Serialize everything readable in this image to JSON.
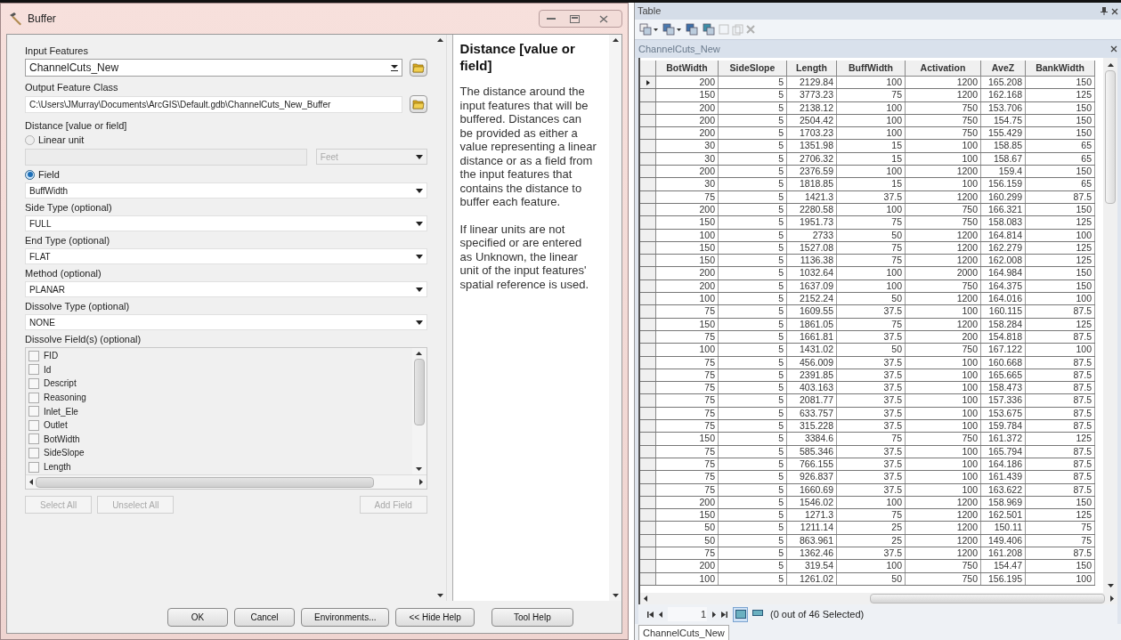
{
  "dialog": {
    "title": "Buffer",
    "params": [
      {
        "kind": "combo",
        "label": "Input Features",
        "value": "ChannelCuts_New"
      },
      {
        "kind": "text",
        "label": "Output Feature Class",
        "value": "C:\\Users\\JMurray\\Documents\\ArcGIS\\Default.gdb\\ChannelCuts_New_Buffer"
      },
      {
        "kind": "distance",
        "label": "Distance [value or field]",
        "options": [
          {
            "label": "Linear unit",
            "selected": false
          },
          {
            "label": "Field",
            "selected": true
          }
        ],
        "unit": "Feet",
        "field": "BuffWidth"
      },
      {
        "kind": "dropdown",
        "label": "Side Type (optional)",
        "value": "FULL"
      },
      {
        "kind": "dropdown",
        "label": "End Type (optional)",
        "value": "FLAT"
      },
      {
        "kind": "dropdown",
        "label": "Method (optional)",
        "value": "PLANAR"
      },
      {
        "kind": "dropdown",
        "label": "Dissolve Type (optional)",
        "value": "NONE"
      },
      {
        "kind": "checklist",
        "label": "Dissolve Field(s) (optional)",
        "items": [
          {
            "label": "FID",
            "checked": false
          },
          {
            "label": "Id",
            "checked": false
          },
          {
            "label": "Descript",
            "checked": false
          },
          {
            "label": "Reasoning",
            "checked": false
          },
          {
            "label": "Inlet_Ele",
            "checked": false
          },
          {
            "label": "Outlet",
            "checked": false
          },
          {
            "label": "BotWidth",
            "checked": false
          },
          {
            "label": "SideSlope",
            "checked": false
          },
          {
            "label": "Length",
            "checked": false
          }
        ],
        "buttons": [
          {
            "label": "Select All",
            "disabled": true
          },
          {
            "label": "Unselect All",
            "disabled": true
          },
          {
            "label": "Add Field",
            "disabled": true
          }
        ]
      }
    ],
    "help": {
      "title": "Distance [value or field]",
      "paragraphs": [
        "The distance around the input features that will be buffered. Distances can be provided as either a value representing a linear distance or as a field from the input features that contains the distance to buffer each feature.",
        "If linear units are not specified or are entered as Unknown, the linear unit of the input features' spatial reference is used."
      ]
    },
    "buttons": [
      "OK",
      "Cancel",
      "Environments...",
      "<< Hide Help"
    ],
    "help_button": "Tool Help"
  },
  "table": {
    "title": "Table",
    "layer_tab": "ChannelCuts_New",
    "columns": [
      "BotWidth",
      "SideSlope",
      "Length",
      "BuffWidth",
      "Activation",
      "AveZ",
      "BankWidth"
    ],
    "rows": [
      {
        "current": true,
        "cells": [
          "200",
          "5",
          "2129.84",
          "100",
          "1200",
          "165.208",
          "150"
        ]
      },
      {
        "current": false,
        "cells": [
          "150",
          "5",
          "3773.23",
          "75",
          "1200",
          "162.168",
          "125"
        ]
      },
      {
        "current": false,
        "cells": [
          "200",
          "5",
          "2138.12",
          "100",
          "750",
          "153.706",
          "150"
        ]
      },
      {
        "current": false,
        "cells": [
          "200",
          "5",
          "2504.42",
          "100",
          "750",
          "154.75",
          "150"
        ]
      },
      {
        "current": false,
        "cells": [
          "200",
          "5",
          "1703.23",
          "100",
          "750",
          "155.429",
          "150"
        ]
      },
      {
        "current": false,
        "cells": [
          "30",
          "5",
          "1351.98",
          "15",
          "100",
          "158.85",
          "65"
        ]
      },
      {
        "current": false,
        "cells": [
          "30",
          "5",
          "2706.32",
          "15",
          "100",
          "158.67",
          "65"
        ]
      },
      {
        "current": false,
        "cells": [
          "200",
          "5",
          "2376.59",
          "100",
          "1200",
          "159.4",
          "150"
        ]
      },
      {
        "current": false,
        "cells": [
          "30",
          "5",
          "1818.85",
          "15",
          "100",
          "156.159",
          "65"
        ]
      },
      {
        "current": false,
        "cells": [
          "75",
          "5",
          "1421.3",
          "37.5",
          "1200",
          "160.299",
          "87.5"
        ]
      },
      {
        "current": false,
        "cells": [
          "200",
          "5",
          "2280.58",
          "100",
          "750",
          "166.321",
          "150"
        ]
      },
      {
        "current": false,
        "cells": [
          "150",
          "5",
          "1951.73",
          "75",
          "750",
          "158.083",
          "125"
        ]
      },
      {
        "current": false,
        "cells": [
          "100",
          "5",
          "2733",
          "50",
          "1200",
          "164.814",
          "100"
        ]
      },
      {
        "current": false,
        "cells": [
          "150",
          "5",
          "1527.08",
          "75",
          "1200",
          "162.279",
          "125"
        ]
      },
      {
        "current": false,
        "cells": [
          "150",
          "5",
          "1136.38",
          "75",
          "1200",
          "162.008",
          "125"
        ]
      },
      {
        "current": false,
        "cells": [
          "200",
          "5",
          "1032.64",
          "100",
          "2000",
          "164.984",
          "150"
        ]
      },
      {
        "current": false,
        "cells": [
          "200",
          "5",
          "1637.09",
          "100",
          "750",
          "164.375",
          "150"
        ]
      },
      {
        "current": false,
        "cells": [
          "100",
          "5",
          "2152.24",
          "50",
          "1200",
          "164.016",
          "100"
        ]
      },
      {
        "current": false,
        "cells": [
          "75",
          "5",
          "1609.55",
          "37.5",
          "100",
          "160.115",
          "87.5"
        ]
      },
      {
        "current": false,
        "cells": [
          "150",
          "5",
          "1861.05",
          "75",
          "1200",
          "158.284",
          "125"
        ]
      },
      {
        "current": false,
        "cells": [
          "75",
          "5",
          "1661.81",
          "37.5",
          "200",
          "154.818",
          "87.5"
        ]
      },
      {
        "current": false,
        "cells": [
          "100",
          "5",
          "1431.02",
          "50",
          "750",
          "167.122",
          "100"
        ]
      },
      {
        "current": false,
        "cells": [
          "75",
          "5",
          "456.009",
          "37.5",
          "100",
          "160.668",
          "87.5"
        ]
      },
      {
        "current": false,
        "cells": [
          "75",
          "5",
          "2391.85",
          "37.5",
          "100",
          "165.665",
          "87.5"
        ]
      },
      {
        "current": false,
        "cells": [
          "75",
          "5",
          "403.163",
          "37.5",
          "100",
          "158.473",
          "87.5"
        ]
      },
      {
        "current": false,
        "cells": [
          "75",
          "5",
          "2081.77",
          "37.5",
          "100",
          "157.336",
          "87.5"
        ]
      },
      {
        "current": false,
        "cells": [
          "75",
          "5",
          "633.757",
          "37.5",
          "100",
          "153.675",
          "87.5"
        ]
      },
      {
        "current": false,
        "cells": [
          "75",
          "5",
          "315.228",
          "37.5",
          "100",
          "159.784",
          "87.5"
        ]
      },
      {
        "current": false,
        "cells": [
          "150",
          "5",
          "3384.6",
          "75",
          "750",
          "161.372",
          "125"
        ]
      },
      {
        "current": false,
        "cells": [
          "75",
          "5",
          "585.346",
          "37.5",
          "100",
          "165.794",
          "87.5"
        ]
      },
      {
        "current": false,
        "cells": [
          "75",
          "5",
          "766.155",
          "37.5",
          "100",
          "164.186",
          "87.5"
        ]
      },
      {
        "current": false,
        "cells": [
          "75",
          "5",
          "926.837",
          "37.5",
          "100",
          "161.439",
          "87.5"
        ]
      },
      {
        "current": false,
        "cells": [
          "75",
          "5",
          "1660.69",
          "37.5",
          "100",
          "163.622",
          "87.5"
        ]
      },
      {
        "current": false,
        "cells": [
          "200",
          "5",
          "1546.02",
          "100",
          "1200",
          "158.969",
          "150"
        ]
      },
      {
        "current": false,
        "cells": [
          "150",
          "5",
          "1271.3",
          "75",
          "1200",
          "162.501",
          "125"
        ]
      },
      {
        "current": false,
        "cells": [
          "50",
          "5",
          "1211.14",
          "25",
          "1200",
          "150.11",
          "75"
        ]
      },
      {
        "current": false,
        "cells": [
          "50",
          "5",
          "863.961",
          "25",
          "1200",
          "149.406",
          "75"
        ]
      },
      {
        "current": false,
        "cells": [
          "75",
          "5",
          "1362.46",
          "37.5",
          "1200",
          "161.208",
          "87.5"
        ]
      },
      {
        "current": false,
        "cells": [
          "200",
          "5",
          "319.54",
          "100",
          "750",
          "154.47",
          "150"
        ]
      },
      {
        "current": false,
        "cells": [
          "100",
          "5",
          "1261.02",
          "50",
          "750",
          "156.195",
          "100"
        ]
      }
    ],
    "record": "1",
    "views": [
      {
        "selected": true
      },
      {
        "selected": false
      }
    ],
    "status": "(0 out of 46 Selected)",
    "bottom_tabs": [
      {
        "label": "ChannelCuts_New",
        "selected": true
      }
    ]
  }
}
